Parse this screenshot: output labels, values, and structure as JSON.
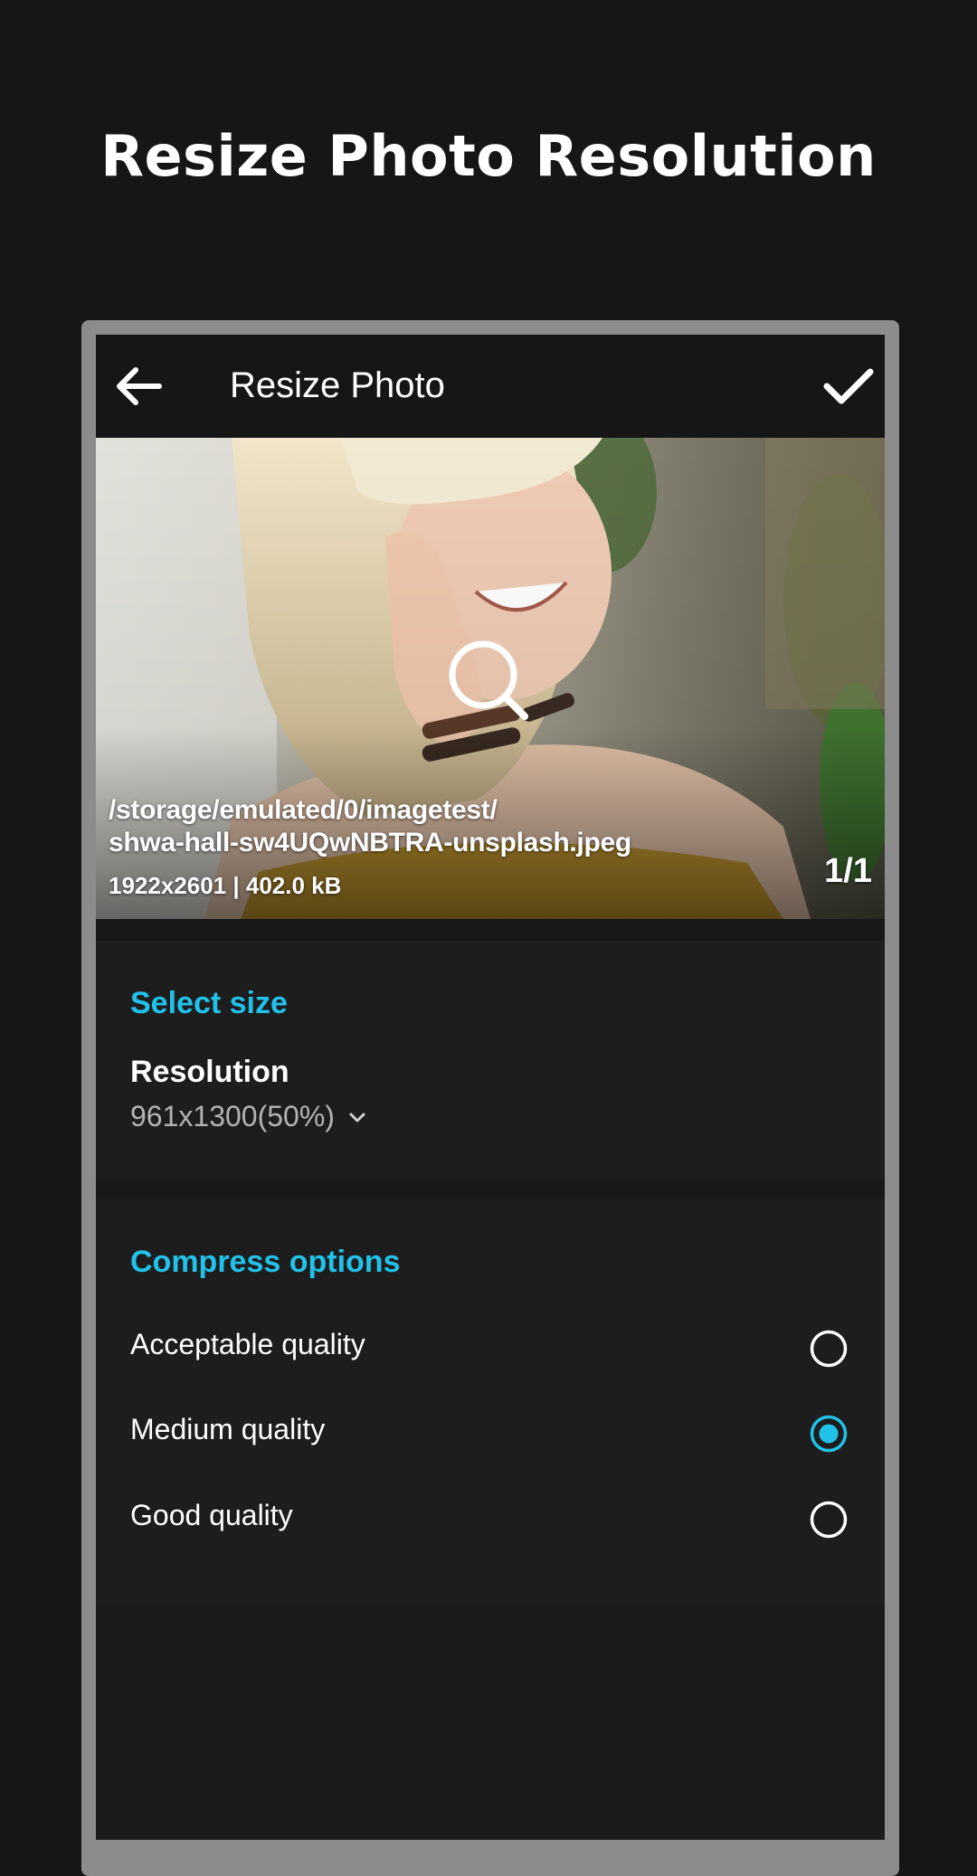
{
  "promo": {
    "title": "Resize Photo Resolution"
  },
  "toolbar": {
    "title": "Resize Photo",
    "back_icon": "arrow-left-icon",
    "confirm_icon": "check-icon"
  },
  "photo": {
    "path_line1": "/storage/emulated/0/imagetest/",
    "path_line2": "shwa-hall-sw4UQwNBTRA-unsplash.jpeg",
    "meta": "1922x2601  |  402.0 kB",
    "counter": "1/1",
    "zoom_icon": "magnifier-icon"
  },
  "size_section": {
    "heading": "Select size",
    "field_label": "Resolution",
    "selected_value": "961x1300(50%)",
    "dropdown_icon": "chevron-down-icon"
  },
  "compress_section": {
    "heading": "Compress options",
    "options": [
      {
        "label": "Acceptable quality",
        "selected": false
      },
      {
        "label": "Medium quality",
        "selected": true
      },
      {
        "label": "Good quality",
        "selected": false
      }
    ]
  },
  "colors": {
    "accent": "#21c2ea",
    "background": "#161617",
    "surface": "#1d1d1e",
    "frame": "#8c8c8c"
  }
}
